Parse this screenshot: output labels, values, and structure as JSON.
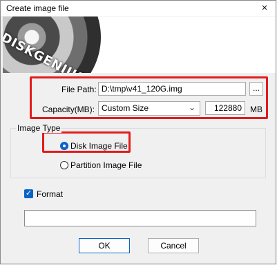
{
  "window": {
    "title": "Create image file",
    "close_icon": "×"
  },
  "banner": {
    "brand": "DISKGENIUS"
  },
  "file_path": {
    "label": "File Path:",
    "value": "D:\\tmp\\v41_120G.img",
    "browse_label": "..."
  },
  "capacity": {
    "label": "Capacity(MB):",
    "selected": "Custom Size",
    "value": "122880",
    "unit": "MB"
  },
  "image_type": {
    "group_label": "Image Type",
    "options": [
      {
        "label": "Disk Image File",
        "selected": true
      },
      {
        "label": "Partition Image File",
        "selected": false
      }
    ]
  },
  "format": {
    "label": "Format",
    "checked": true
  },
  "buttons": {
    "ok": "OK",
    "cancel": "Cancel"
  },
  "colors": {
    "highlight": "#e21b1b",
    "accent": "#0a64c8"
  }
}
